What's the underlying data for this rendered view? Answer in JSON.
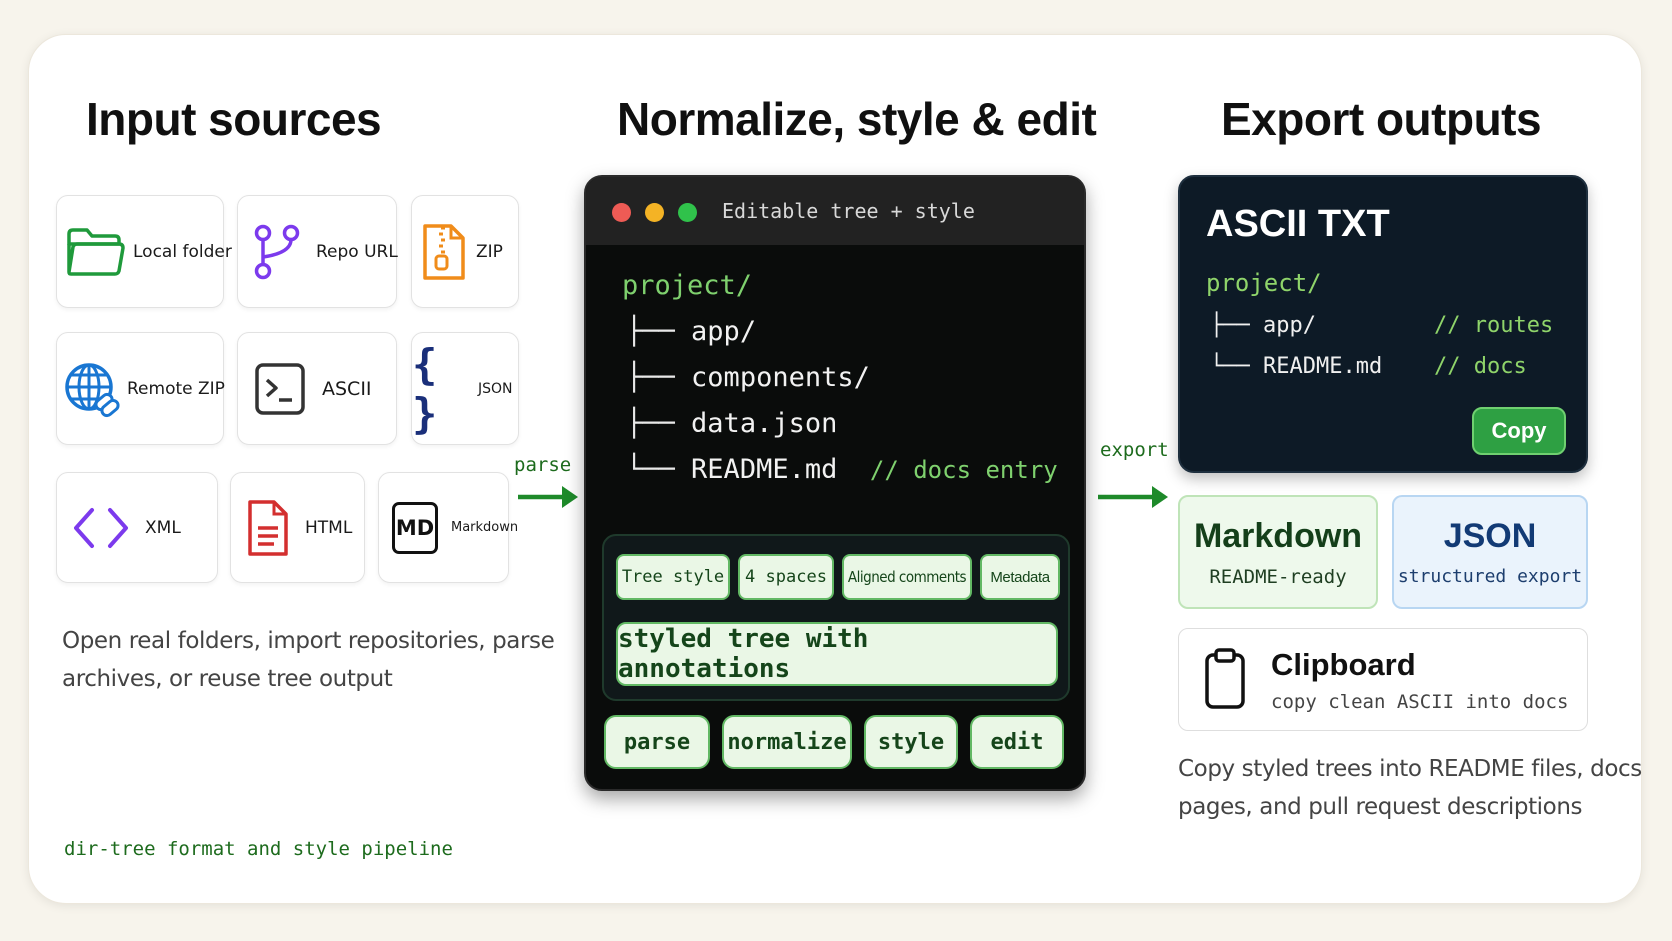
{
  "headings": {
    "inputs": "Input sources",
    "process": "Normalize, style & edit",
    "outputs": "Export outputs"
  },
  "inputs": {
    "local_folder": "Local folder",
    "repo_url": "Repo URL",
    "zip": "ZIP",
    "remote_zip": "Remote ZIP",
    "ascii": "ASCII",
    "json": "JSON",
    "xml": "XML",
    "html": "HTML",
    "markdown": "Markdown",
    "md_glyph": "MD",
    "description_line1": "Open real folders, import repositories, parse",
    "description_line2": "archives, or reuse tree output"
  },
  "footer_tag": "dir-tree format and style pipeline",
  "arrows": {
    "parse": "parse",
    "export": "export"
  },
  "editor": {
    "title": "Editable tree + style",
    "root": "project/",
    "lines": [
      {
        "branch": "├──",
        "name": "app/",
        "comment": ""
      },
      {
        "branch": "├──",
        "name": "components/",
        "comment": ""
      },
      {
        "branch": "├──",
        "name": "data.json",
        "comment": ""
      },
      {
        "branch": "└──",
        "name": "README.md",
        "comment": "// docs entry"
      }
    ],
    "options": [
      "Tree style",
      "4 spaces",
      "Aligned comments",
      "Metadata"
    ],
    "styled_label": "styled tree with annotations",
    "steps": [
      "parse",
      "normalize",
      "style",
      "edit"
    ]
  },
  "outputs": {
    "ascii_title": "ASCII TXT",
    "ascii_root": "project/",
    "ascii_lines": [
      {
        "branch": "├──",
        "name": "app/",
        "comment": "// routes"
      },
      {
        "branch": "└──",
        "name": "README.md",
        "comment": "// docs"
      }
    ],
    "copy_label": "Copy",
    "markdown_title": "Markdown",
    "markdown_sub": "README-ready",
    "json_title": "JSON",
    "json_sub": "structured export",
    "clipboard_title": "Clipboard",
    "clipboard_sub": "copy clean ASCII into docs",
    "description_line1": "Copy styled trees into README files, docs",
    "description_line2": "pages, and pull request descriptions"
  },
  "colors": {
    "accent_green": "#2ea043",
    "code_green": "#7fd16e",
    "editor_bg": "#0a0c0b",
    "ascii_panel_bg": "#0d1a26",
    "markdown_bg": "#eef9ec",
    "json_bg": "#eaf3fc"
  }
}
